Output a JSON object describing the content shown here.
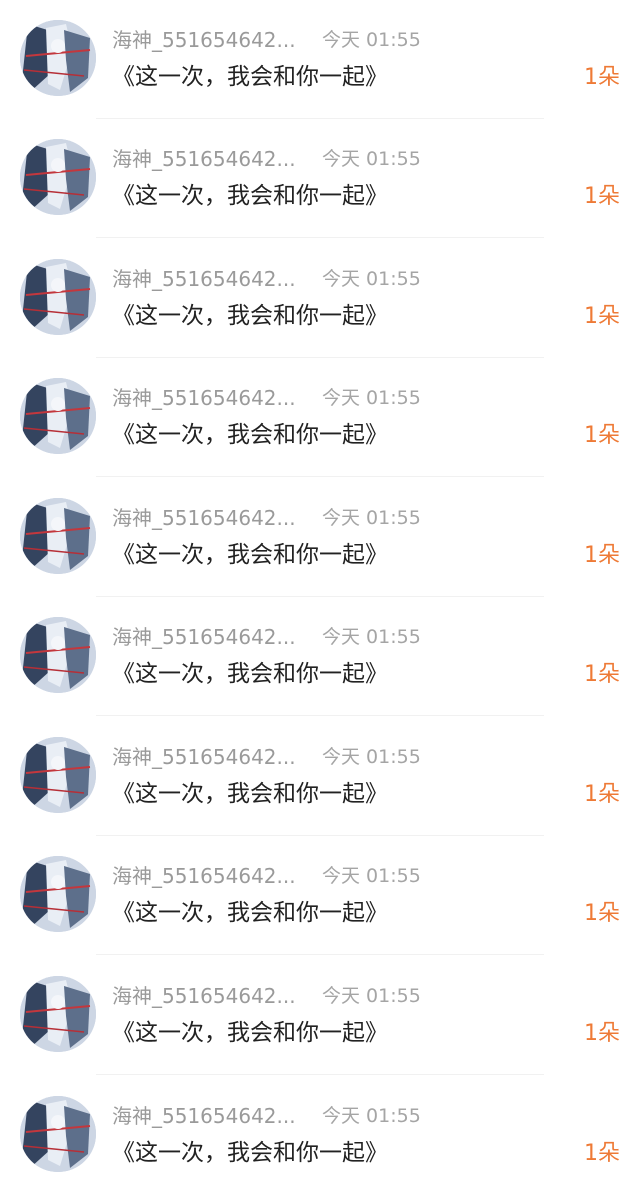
{
  "gift_list": {
    "rows": [
      {
        "username": "海神_551654642...",
        "time": "今天 01:55",
        "message": "《这一次，我会和你一起》",
        "gift_count": "1朵"
      },
      {
        "username": "海神_551654642...",
        "time": "今天 01:55",
        "message": "《这一次，我会和你一起》",
        "gift_count": "1朵"
      },
      {
        "username": "海神_551654642...",
        "time": "今天 01:55",
        "message": "《这一次，我会和你一起》",
        "gift_count": "1朵"
      },
      {
        "username": "海神_551654642...",
        "time": "今天 01:55",
        "message": "《这一次，我会和你一起》",
        "gift_count": "1朵"
      },
      {
        "username": "海神_551654642...",
        "time": "今天 01:55",
        "message": "《这一次，我会和你一起》",
        "gift_count": "1朵"
      },
      {
        "username": "海神_551654642...",
        "time": "今天 01:55",
        "message": "《这一次，我会和你一起》",
        "gift_count": "1朵"
      },
      {
        "username": "海神_551654642...",
        "time": "今天 01:55",
        "message": "《这一次，我会和你一起》",
        "gift_count": "1朵"
      },
      {
        "username": "海神_551654642...",
        "time": "今天 01:55",
        "message": "《这一次，我会和你一起》",
        "gift_count": "1朵"
      },
      {
        "username": "海神_551654642...",
        "time": "今天 01:55",
        "message": "《这一次，我会和你一起》",
        "gift_count": "1朵"
      },
      {
        "username": "海神_551654642...",
        "time": "今天 01:55",
        "message": "《这一次，我会和你一起》",
        "gift_count": "1朵"
      }
    ]
  },
  "colors": {
    "background": "#ffffff",
    "username": "#9a9a9a",
    "time": "#a5a5a5",
    "message": "#222222",
    "gift_count_accent": "#ee7a36",
    "divider": "#f1f1f1"
  }
}
